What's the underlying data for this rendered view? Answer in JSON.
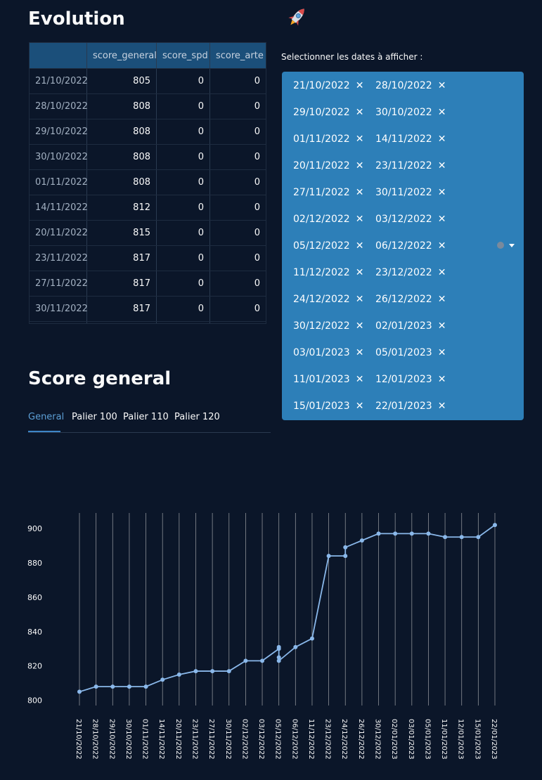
{
  "header": {
    "title": "Evolution",
    "icon": "rocket-icon"
  },
  "table": {
    "columns": [
      "",
      "score_general",
      "score_spd",
      "score_arte"
    ],
    "rows": [
      {
        "date": "21/10/2022",
        "score_general": "805",
        "score_spd": "0",
        "score_arte": "0"
      },
      {
        "date": "28/10/2022",
        "score_general": "808",
        "score_spd": "0",
        "score_arte": "0"
      },
      {
        "date": "29/10/2022",
        "score_general": "808",
        "score_spd": "0",
        "score_arte": "0"
      },
      {
        "date": "30/10/2022",
        "score_general": "808",
        "score_spd": "0",
        "score_arte": "0"
      },
      {
        "date": "01/11/2022",
        "score_general": "808",
        "score_spd": "0",
        "score_arte": "0"
      },
      {
        "date": "14/11/2022",
        "score_general": "812",
        "score_spd": "0",
        "score_arte": "0"
      },
      {
        "date": "20/11/2022",
        "score_general": "815",
        "score_spd": "0",
        "score_arte": "0"
      },
      {
        "date": "23/11/2022",
        "score_general": "817",
        "score_spd": "0",
        "score_arte": "0"
      },
      {
        "date": "27/11/2022",
        "score_general": "817",
        "score_spd": "0",
        "score_arte": "0"
      },
      {
        "date": "30/11/2022",
        "score_general": "817",
        "score_spd": "0",
        "score_arte": "0"
      }
    ]
  },
  "date_select": {
    "label": "Selectionner les dates à afficher :",
    "remove_glyph": "✕",
    "selected": [
      "21/10/2022",
      "28/10/2022",
      "29/10/2022",
      "30/10/2022",
      "01/11/2022",
      "14/11/2022",
      "20/11/2022",
      "23/11/2022",
      "27/11/2022",
      "30/11/2022",
      "02/12/2022",
      "03/12/2022",
      "05/12/2022",
      "06/12/2022",
      "11/12/2022",
      "23/12/2022",
      "24/12/2022",
      "26/12/2022",
      "30/12/2022",
      "02/01/2023",
      "03/01/2023",
      "05/01/2023",
      "11/01/2023",
      "12/01/2023",
      "15/01/2023",
      "22/01/2023"
    ],
    "accent": "#2d7fb8"
  },
  "score_section": {
    "title": "Score general",
    "tabs": [
      "General",
      "Palier 100",
      "Palier 110",
      "Palier 120"
    ],
    "active_tab": 0
  },
  "chart_data": {
    "type": "line",
    "categories": [
      "21/10/2022",
      "28/10/2022",
      "29/10/2022",
      "30/10/2022",
      "01/11/2022",
      "14/11/2022",
      "20/11/2022",
      "23/11/2022",
      "27/11/2022",
      "30/11/2022",
      "02/12/2022",
      "03/12/2022",
      "05/12/2022",
      "06/12/2022",
      "11/12/2022",
      "23/12/2022",
      "24/12/2022",
      "26/12/2022",
      "30/12/2022",
      "02/01/2023",
      "03/01/2023",
      "05/01/2023",
      "11/01/2023",
      "12/01/2023",
      "15/01/2023",
      "22/01/2023"
    ],
    "points": [
      {
        "x": "21/10/2022",
        "y": 805
      },
      {
        "x": "28/10/2022",
        "y": 808
      },
      {
        "x": "29/10/2022",
        "y": 808
      },
      {
        "x": "30/10/2022",
        "y": 808
      },
      {
        "x": "01/11/2022",
        "y": 808
      },
      {
        "x": "14/11/2022",
        "y": 812
      },
      {
        "x": "20/11/2022",
        "y": 815
      },
      {
        "x": "23/11/2022",
        "y": 817
      },
      {
        "x": "27/11/2022",
        "y": 817
      },
      {
        "x": "30/11/2022",
        "y": 817
      },
      {
        "x": "02/12/2022",
        "y": 823
      },
      {
        "x": "03/12/2022",
        "y": 823
      },
      {
        "x": "05/12/2022",
        "y": 830
      },
      {
        "x": "05/12/2022",
        "y": 831
      },
      {
        "x": "05/12/2022",
        "y": 825
      },
      {
        "x": "05/12/2022",
        "y": 823
      },
      {
        "x": "06/12/2022",
        "y": 831
      },
      {
        "x": "11/12/2022",
        "y": 836
      },
      {
        "x": "23/12/2022",
        "y": 884
      },
      {
        "x": "24/12/2022",
        "y": 884
      },
      {
        "x": "24/12/2022",
        "y": 889
      },
      {
        "x": "26/12/2022",
        "y": 893
      },
      {
        "x": "30/12/2022",
        "y": 897
      },
      {
        "x": "02/01/2023",
        "y": 897
      },
      {
        "x": "03/01/2023",
        "y": 897
      },
      {
        "x": "05/01/2023",
        "y": 897
      },
      {
        "x": "11/01/2023",
        "y": 895
      },
      {
        "x": "12/01/2023",
        "y": 895
      },
      {
        "x": "15/01/2023",
        "y": 895
      },
      {
        "x": "22/01/2023",
        "y": 902
      }
    ],
    "yticks": [
      800,
      820,
      840,
      860,
      880,
      900
    ],
    "ylim": [
      797,
      909
    ],
    "grid": "vertical",
    "line_color": "#8ab8ea"
  }
}
